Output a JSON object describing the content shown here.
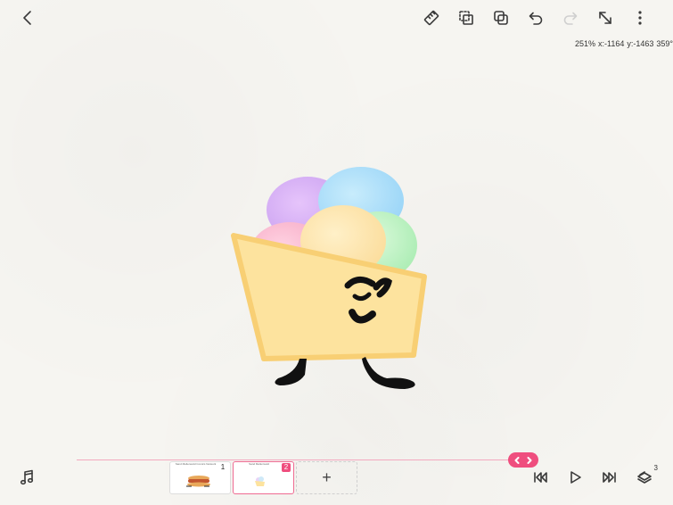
{
  "status": {
    "zoom": "251%",
    "x": "x:-1164",
    "y": "y:-1463",
    "rotation": "359°"
  },
  "timeline": {
    "frames": [
      {
        "number": "1",
        "title": "Sand Mellenwold Comics Network"
      },
      {
        "number": "2",
        "title": "Sand Mellenwold"
      }
    ],
    "add_label": "+",
    "layers_count": "3"
  },
  "colors": {
    "accent": "#ef4e7e",
    "timeline_line": "#f3a9bf",
    "paper": "#f6f5f1"
  },
  "icons": {
    "back": "chevron-left-icon",
    "ruler": "ruler-icon",
    "transform": "transform-select-icon",
    "copy": "copy-icon",
    "undo": "undo-icon",
    "redo": "redo-icon",
    "fullscreen": "expand-icon",
    "more": "more-vertical-icon",
    "music": "music-note-icon",
    "first": "skip-to-start-icon",
    "play": "play-icon",
    "last": "skip-to-end-icon",
    "layers": "layers-icon"
  }
}
